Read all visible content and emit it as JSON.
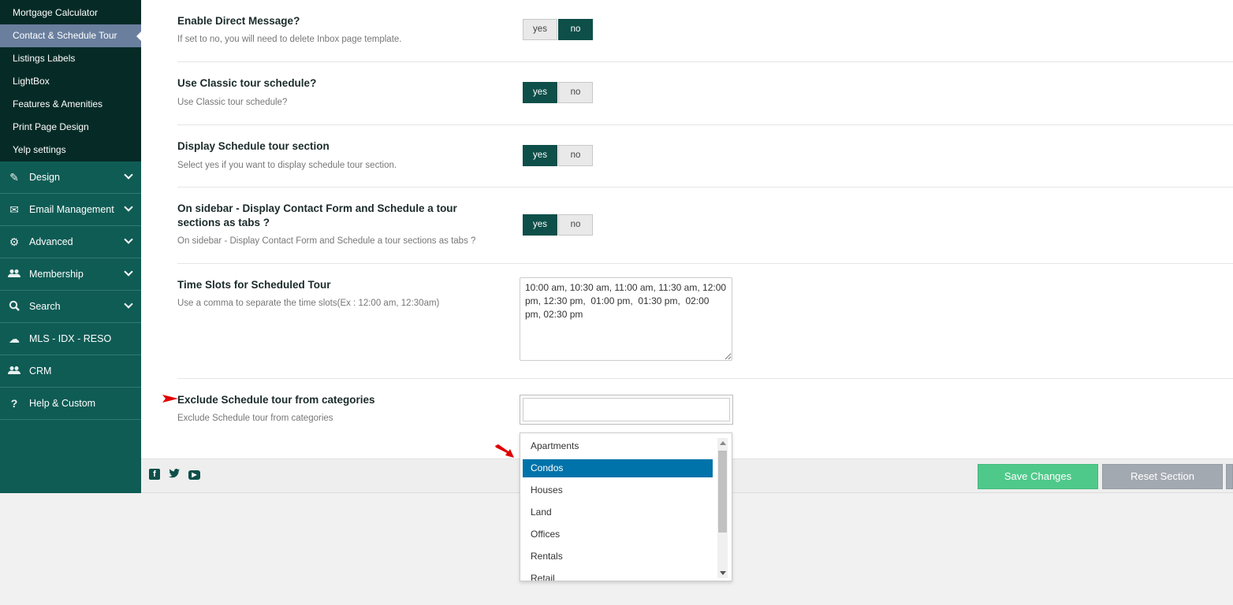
{
  "sidebar": {
    "sub_items": [
      {
        "label": "Mortgage Calculator"
      },
      {
        "label": "Contact & Schedule Tour"
      },
      {
        "label": "Listings Labels"
      },
      {
        "label": "LightBox"
      },
      {
        "label": "Features & Amenities"
      },
      {
        "label": "Print Page Design"
      },
      {
        "label": "Yelp settings"
      }
    ],
    "nav_items": [
      {
        "label": "Design",
        "icon": "pencil-icon"
      },
      {
        "label": "Email Management",
        "icon": "envelope-icon"
      },
      {
        "label": "Advanced",
        "icon": "gear-icon"
      },
      {
        "label": "Membership",
        "icon": "users-icon"
      },
      {
        "label": "Search",
        "icon": "search-icon"
      },
      {
        "label": "MLS - IDX - RESO",
        "icon": "cloud-icon"
      },
      {
        "label": "CRM",
        "icon": "users-icon"
      },
      {
        "label": "Help & Custom",
        "icon": "question-icon"
      }
    ]
  },
  "settings": {
    "direct_message": {
      "title": "Enable Direct Message?",
      "desc": "If set to no, you will need to delete Inbox page template.",
      "yes": "yes",
      "no": "no",
      "value": "no"
    },
    "classic_tour": {
      "title": "Use Classic tour schedule?",
      "desc": "Use Classic tour schedule?",
      "yes": "yes",
      "no": "no",
      "value": "yes"
    },
    "display_tour": {
      "title": "Display Schedule tour section",
      "desc": "Select yes if you want to display schedule tour section.",
      "yes": "yes",
      "no": "no",
      "value": "yes"
    },
    "sidebar_tabs": {
      "title": "On sidebar - Display Contact Form and Schedule a tour sections as tabs ?",
      "desc": "On sidebar - Display Contact Form and Schedule a tour sections as tabs ?",
      "yes": "yes",
      "no": "no",
      "value": "yes"
    },
    "time_slots": {
      "title": "Time Slots for Scheduled Tour",
      "desc": "Use a comma to separate the time slots(Ex : 12:00 am, 12:30am)",
      "value": "10:00 am, 10:30 am, 11:00 am, 11:30 am, 12:00 pm, 12:30 pm,  01:00 pm,  01:30 pm,  02:00 pm, 02:30 pm"
    },
    "exclude_categories": {
      "title": "Exclude Schedule tour from categories",
      "desc": "Exclude Schedule tour from categories",
      "search_value": ""
    }
  },
  "dropdown": {
    "options": [
      "Apartments",
      "Condos",
      "Houses",
      "Land",
      "Offices",
      "Rentals",
      "Retail"
    ],
    "selected": "Condos"
  },
  "footer": {
    "save_label": "Save Changes",
    "reset_label": "Reset Section"
  },
  "colors": {
    "sidebar_bg": "#0f5c55",
    "subnav_bg": "#062b27",
    "toggle_on": "#0e4f49",
    "save_green": "#4fc98a",
    "reset_gray": "#a3a9b0",
    "selected_option": "#0073aa",
    "annotation_red": "#e00000"
  }
}
